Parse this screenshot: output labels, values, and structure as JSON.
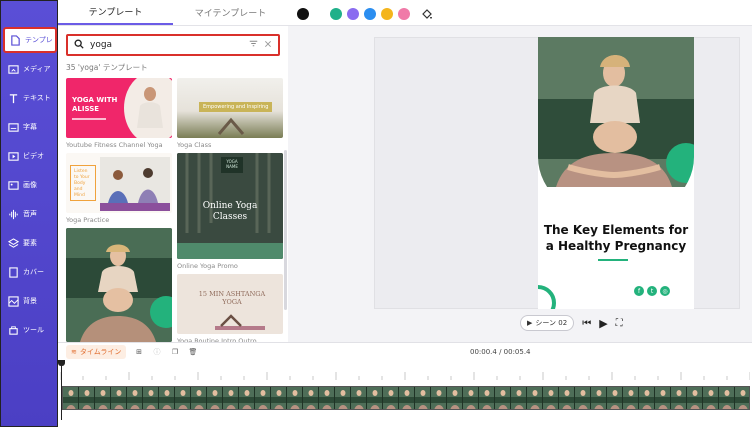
{
  "sidebar": {
    "items": [
      {
        "label": "テンプレ",
        "icon": "template-icon"
      },
      {
        "label": "メディア",
        "icon": "media-icon"
      },
      {
        "label": "テキスト",
        "icon": "text-icon"
      },
      {
        "label": "字幕",
        "icon": "subtitle-icon"
      },
      {
        "label": "ビデオ",
        "icon": "video-icon"
      },
      {
        "label": "画像",
        "icon": "image-icon"
      },
      {
        "label": "音声",
        "icon": "audio-icon"
      },
      {
        "label": "要素",
        "icon": "elements-icon"
      },
      {
        "label": "カバー",
        "icon": "cover-icon"
      },
      {
        "label": "背景",
        "icon": "background-icon"
      },
      {
        "label": "ツール",
        "icon": "tools-icon"
      }
    ]
  },
  "tabs": {
    "templates": "テンプレート",
    "my_templates": "マイテンプレート"
  },
  "search": {
    "value": "yoga"
  },
  "results": {
    "count_text": "35 'yoga' テンプレート"
  },
  "templates": [
    {
      "caption": "Youtube Fitness Channel Yoga",
      "title": "YOGA WITH ALISSE"
    },
    {
      "caption": "Yoga Class",
      "title": "Empowering and Inspiring"
    },
    {
      "caption": "Yoga Practice",
      "title": "Listen to Your Body and Mind"
    },
    {
      "caption": "Online Yoga Promo",
      "title": "Online Yoga Classes",
      "logo": "YOGA NAME"
    },
    {
      "caption": "",
      "title": ""
    },
    {
      "caption": "Yoga Routine Intro Outro",
      "title": "15 MIN ASHTANGA YOGA"
    }
  ],
  "colors": {
    "swatches": [
      "#111111",
      "#20b08a",
      "#8a6cf0",
      "#2b8ef0",
      "#f4b51c",
      "#f07aa8"
    ],
    "accent": "#5a4fd6",
    "highlight": "#d9302b"
  },
  "poster": {
    "title_line1": "The Key Elements for",
    "title_line2": "a Healthy Pregnancy"
  },
  "player": {
    "scene_label": "シーン 02"
  },
  "timeline": {
    "label": "タイムライン",
    "time": "00:00.4 / 00:05.4"
  }
}
